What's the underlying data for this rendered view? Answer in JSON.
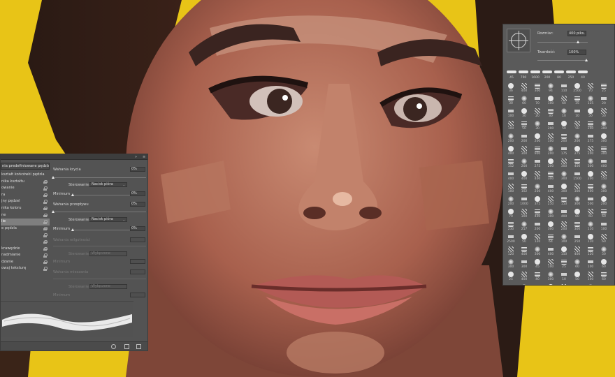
{
  "brush_settings_panel": {
    "preset_button": "nia predefiniowane pędzla",
    "options": [
      {
        "label": "kształt końcówki pędzla",
        "display": "kształt końcówki pędzla",
        "lock": false,
        "active": false
      },
      {
        "label": "nika kształtu",
        "display": "nika kształtu",
        "lock": true,
        "active": false
      },
      {
        "label": "owanie",
        "display": "owanie",
        "lock": true,
        "active": false
      },
      {
        "label": "ra",
        "display": "ra",
        "lock": true,
        "active": false
      },
      {
        "label": "jny pędzel",
        "display": "jny pędzel",
        "lock": true,
        "active": false
      },
      {
        "label": "nika koloru",
        "display": "nika koloru",
        "lock": true,
        "active": false
      },
      {
        "label": "ne",
        "display": "ne",
        "lock": true,
        "active": false
      },
      {
        "label": "lie",
        "display": "lie",
        "lock": true,
        "active": true
      },
      {
        "label": "e pędzla",
        "display": "e pędzla",
        "lock": true,
        "active": false
      },
      {
        "label": "",
        "display": "",
        "lock": true,
        "active": false
      },
      {
        "label": "",
        "display": "",
        "lock": true,
        "active": false
      },
      {
        "label": "krawędzie",
        "display": "krawędzie",
        "lock": true,
        "active": false
      },
      {
        "label": "nadmianie",
        "display": "nadmianie",
        "lock": true,
        "active": false
      },
      {
        "label": "dzanie",
        "display": "dzanie",
        "lock": true,
        "active": false
      },
      {
        "label": "owaj teksturę",
        "display": "owaj teksturę",
        "lock": true,
        "active": false
      }
    ],
    "settings": {
      "flow_jitter_label": "Wahania krycia",
      "flow_jitter_value": "0%",
      "control1_label": "Sterowanie:",
      "control1_value": "Nacisk pióra",
      "minimum1_label": "Minimum",
      "minimum1_value": "0%",
      "flow_var_label": "Wahania przepływu",
      "flow_var_value": "0%",
      "control2_label": "Sterowanie:",
      "control2_value": "Nacisk pióra",
      "minimum2_label": "Minimum",
      "minimum2_value": "0%",
      "wet_label": "Wahania wilgotności",
      "control3_label": "Sterowanie:",
      "control3_value": "Wyłączone",
      "minimum3_label": "Minimum",
      "mix_label": "Wahania mieszania",
      "control4_label": "Sterowanie:",
      "control4_value": "Wyłączone",
      "minimum4_label": "Minimum"
    },
    "header_controls": {
      "collapse": "»",
      "menu": "≡"
    }
  },
  "brush_preset_panel": {
    "size_label": "Rozmiar:",
    "size_value": "400 piks.",
    "hardness_label": "Twardość:",
    "hardness_value": "100%",
    "recent_sizes": [
      "45",
      "790",
      "1600",
      "200",
      "80",
      "250",
      "40"
    ],
    "grid_numbers": [
      "36",
      "400",
      "300",
      "94",
      "110",
      "2500",
      "70",
      "25",
      "30",
      "60",
      "70",
      "100",
      "60",
      "35",
      "125",
      "20",
      "100",
      "30",
      "20",
      "30",
      "10",
      "10",
      "50",
      "50",
      "100",
      "50",
      "30",
      "200",
      "50",
      "50",
      "200",
      "300",
      "200",
      "200",
      "200",
      "100",
      "200",
      "200",
      "275",
      "300",
      "400",
      "300",
      "900",
      "200",
      "175",
      "275",
      "200",
      "300",
      "152",
      "200",
      "275",
      "200",
      "300",
      "400",
      "300",
      "400",
      "400",
      "400",
      "400",
      "300",
      "300",
      "1500",
      "200",
      "150",
      "100",
      "102",
      "250",
      "400",
      "300",
      "300",
      "400",
      "300",
      "200",
      "1000",
      "375",
      "250",
      "150",
      "300",
      "500",
      "200",
      "70",
      "300",
      "400",
      "300",
      "400",
      "60",
      "60",
      "60",
      "230",
      "257",
      "200",
      "300",
      "200",
      "300",
      "110",
      "100",
      "2500",
      "50",
      "120",
      "64",
      "100",
      "250",
      "110",
      "60",
      "120",
      "400",
      "300",
      "400",
      "150",
      "400",
      "120",
      "50",
      "300",
      "300",
      "45",
      "100",
      "25",
      "60",
      "100",
      "60",
      "25",
      "400",
      "40",
      "300",
      "10",
      "50",
      "100",
      "60",
      "150",
      "150",
      "45",
      "25",
      "50",
      "50",
      "60",
      "60",
      "80",
      "200",
      "100",
      "100",
      "100",
      "125",
      "60",
      "100"
    ]
  },
  "colors": {
    "panel_bg": "#535353",
    "panel_dark": "#3d3d3d",
    "background_yellow": "#e8c417",
    "skin_tone": "#b5715c"
  }
}
